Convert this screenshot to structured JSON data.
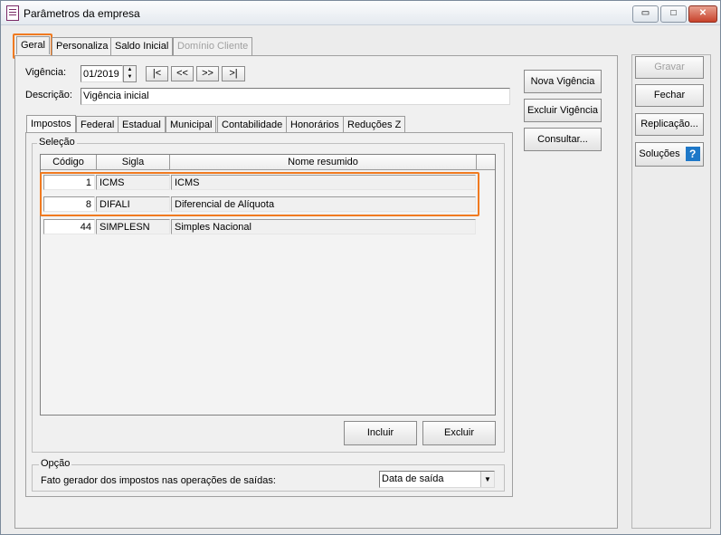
{
  "window": {
    "title": "Parâmetros da empresa",
    "minimize_glyph": "▭",
    "maximize_glyph": "□",
    "close_glyph": "✕"
  },
  "main_tabs": [
    {
      "label": "Geral"
    },
    {
      "label": "Personaliza"
    },
    {
      "label": "Saldo Inicial"
    },
    {
      "label": "Domínio Cliente"
    }
  ],
  "vigencia": {
    "label": "Vigência:",
    "value": "01/2019",
    "nav": [
      "|<",
      "<<",
      ">>",
      ">|"
    ]
  },
  "descricao": {
    "label": "Descrição:",
    "value": "Vigência inicial"
  },
  "sub_tabs": [
    {
      "label": "Impostos"
    },
    {
      "label": "Federal"
    },
    {
      "label": "Estadual"
    },
    {
      "label": "Municipal"
    },
    {
      "label": "Contabilidade"
    },
    {
      "label": "Honorários"
    },
    {
      "label": "Reduções Z"
    }
  ],
  "selecao": {
    "title": "Seleção",
    "columns": [
      "Código",
      "Sigla",
      "Nome resumido"
    ],
    "rows": [
      {
        "codigo": "1",
        "sigla": "ICMS",
        "nome": "ICMS"
      },
      {
        "codigo": "8",
        "sigla": "DIFALI",
        "nome": "Diferencial de Alíquota"
      },
      {
        "codigo": "44",
        "sigla": "SIMPLESN",
        "nome": "Simples Nacional"
      }
    ],
    "incluir": "Incluir",
    "excluir": "Excluir"
  },
  "opcao": {
    "title": "Opção",
    "label": "Fato gerador dos impostos nas operações de saídas:",
    "selected": "Data de saída"
  },
  "vigencia_buttons": {
    "nova": "Nova Vigência",
    "excluir": "Excluir Vigência",
    "consultar": "Consultar..."
  },
  "side_buttons": {
    "gravar": "Gravar",
    "fechar": "Fechar",
    "replicacao": "Replicação...",
    "solucoes": "Soluções",
    "help": "?"
  },
  "colors": {
    "highlight": "#f07a20",
    "help_icon": "#1e78c8"
  }
}
